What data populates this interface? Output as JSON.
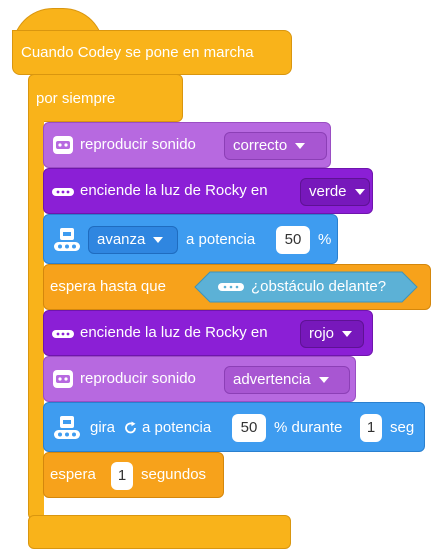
{
  "hat": {
    "label": "Cuando Codey se pone en marcha"
  },
  "forever": {
    "label": "por siempre"
  },
  "blocks": {
    "play1": {
      "label": "reproducir sonido",
      "value": "correcto"
    },
    "led1": {
      "label": "enciende la luz de Rocky en",
      "value": "verde"
    },
    "move": {
      "direction": "avanza",
      "label": "a potencia",
      "power": "50",
      "unit": "%"
    },
    "wait_until": {
      "label": "espera hasta que",
      "condition": "¿obstáculo delante?"
    },
    "led2": {
      "label": "enciende la luz de Rocky en",
      "value": "rojo"
    },
    "play2": {
      "label": "reproducir sonido",
      "value": "advertencia"
    },
    "turn": {
      "label": "gira",
      "label2": "a potencia",
      "power": "50",
      "label3": "% durante",
      "duration": "1",
      "unit": "seg"
    },
    "wait": {
      "label": "espera",
      "value": "1",
      "unit": "segundos"
    }
  },
  "colors": {
    "events": "#f9b31a",
    "control": "#f7a21b",
    "sound": "#b769e0",
    "light": "#8b1fd6",
    "motion": "#3e9cf0",
    "sensing": "#5cb1d6"
  },
  "icons": {
    "sound": "codey-face-icon",
    "light": "led-strip-icon",
    "motion": "rocky-robot-icon",
    "sensor": "sensor-icon",
    "turn": "rotate-clockwise-icon"
  }
}
